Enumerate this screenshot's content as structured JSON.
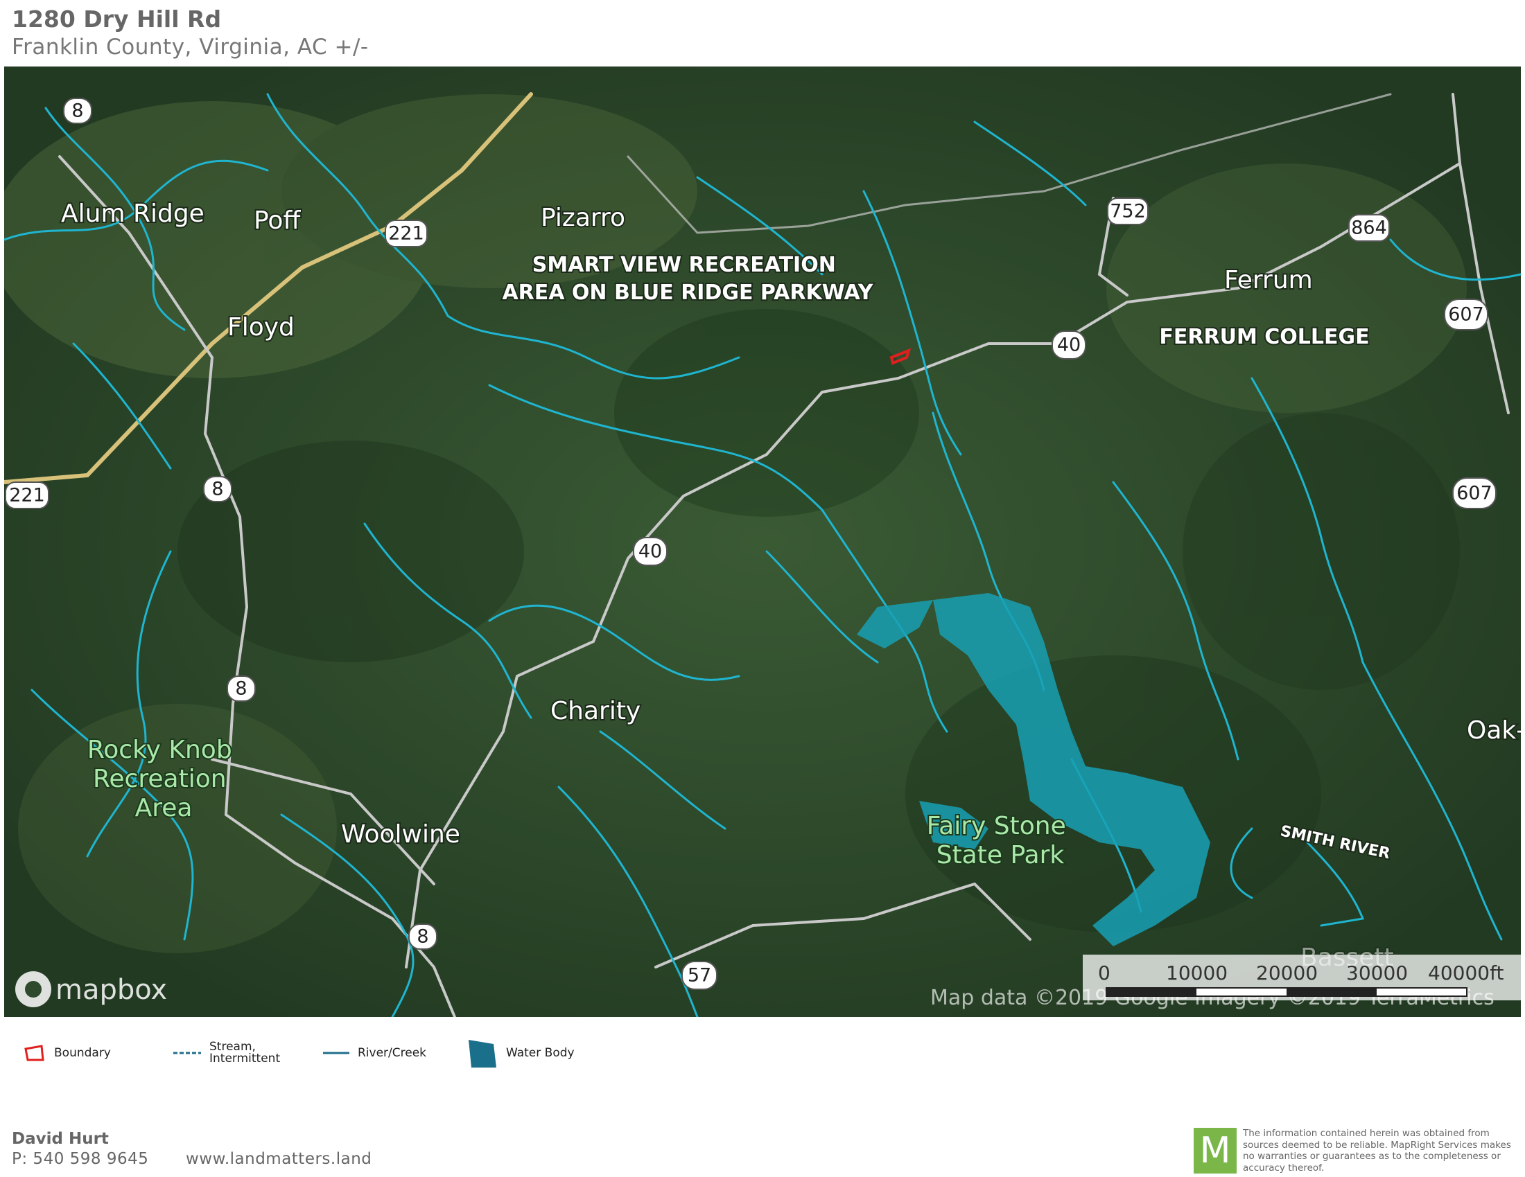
{
  "header": {
    "title": "1280 Dry Hill Rd",
    "subtitle": "Franklin County, Virginia,  AC +/-"
  },
  "map": {
    "places": [
      {
        "id": "alum-ridge",
        "name": "Alum Ridge"
      },
      {
        "id": "poff",
        "name": "Poff"
      },
      {
        "id": "floyd",
        "name": "Floyd"
      },
      {
        "id": "pizarro",
        "name": "Pizarro"
      },
      {
        "id": "ferrum",
        "name": "Ferrum"
      },
      {
        "id": "charity",
        "name": "Charity"
      },
      {
        "id": "woolwine",
        "name": "Woolwine"
      },
      {
        "id": "oak",
        "name": "Oak-"
      },
      {
        "id": "bassett",
        "name": "Bassett"
      }
    ],
    "parks": [
      {
        "id": "rocky-knob",
        "lines": [
          "Rocky Knob",
          "Recreation",
          "Area"
        ]
      },
      {
        "id": "fairy-stone",
        "lines": [
          "Fairy Stone",
          "State Park"
        ]
      }
    ],
    "poi": [
      {
        "id": "smart-view",
        "lines": [
          "SMART VIEW RECREATION",
          "AREA ON BLUE RIDGE PARKWAY"
        ]
      },
      {
        "id": "ferrum-college",
        "lines": [
          "FERRUM COLLEGE"
        ]
      }
    ],
    "river_label": "SMITH RIVER",
    "shields": [
      {
        "id": "r8-a",
        "label": "8"
      },
      {
        "id": "r221-a",
        "label": "221"
      },
      {
        "id": "r221-b",
        "label": "221"
      },
      {
        "id": "r8-b",
        "label": "8"
      },
      {
        "id": "r8-c",
        "label": "8"
      },
      {
        "id": "r8-d",
        "label": "8"
      },
      {
        "id": "r752",
        "label": "752"
      },
      {
        "id": "r864",
        "label": "864"
      },
      {
        "id": "r40-a",
        "label": "40"
      },
      {
        "id": "r40-b",
        "label": "40"
      },
      {
        "id": "r607-a",
        "label": "607"
      },
      {
        "id": "r607-b",
        "label": "607"
      },
      {
        "id": "r57",
        "label": "57"
      }
    ],
    "attribution_logo": "mapbox",
    "attribution_text": "Map data ©2019 Google Imagery ©2019 TerraMetrics",
    "scale": {
      "labels": [
        "0",
        "10000",
        "20000",
        "30000",
        "40000ft"
      ]
    },
    "colors": {
      "water": "#1fb5d0",
      "lake": "#18a0b4",
      "road": "#c9c9c9",
      "boundary": "#e0201e",
      "highway": "#d8c27a"
    }
  },
  "legend": [
    {
      "id": "boundary",
      "label": "Boundary"
    },
    {
      "id": "stream",
      "label_lines": [
        "Stream,",
        "Intermittent"
      ]
    },
    {
      "id": "river",
      "label": "River/Creek"
    },
    {
      "id": "water",
      "label": "Water Body"
    }
  ],
  "contact": {
    "name": "David Hurt",
    "phone": "P: 540 598 9645",
    "website": "www.landmatters.land"
  },
  "brand": {
    "logo_letter": "M",
    "disclaimer": "The information contained herein was obtained from sources deemed to be reliable. MapRight Services makes no warranties or guarantees as to the completeness or accuracy thereof."
  }
}
